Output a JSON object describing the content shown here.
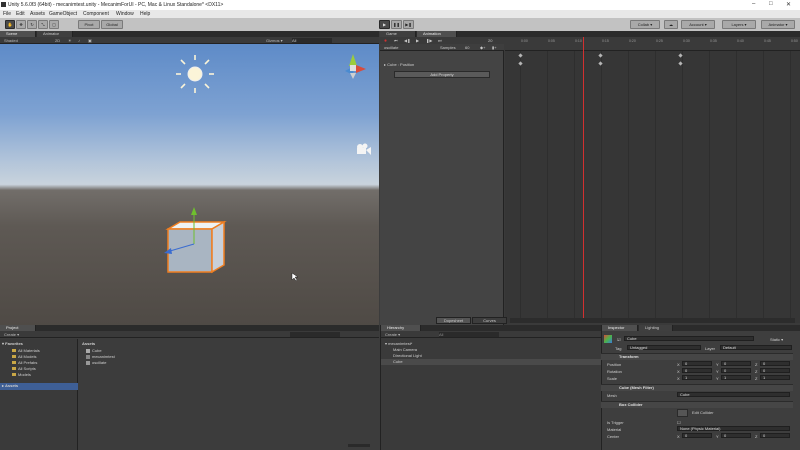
{
  "window": {
    "title": "Unity 5.6.0f3 (64bit) - mecanimtest.unity - MecanimForUI - PC, Mac & Linux Standalone* <DX11>",
    "minimize": "–",
    "maximize": "□",
    "close": "✕"
  },
  "menu": [
    "File",
    "Edit",
    "Assets",
    "GameObject",
    "Component",
    "Window",
    "Help"
  ],
  "toolbar": {
    "pivot": "Pivot",
    "global": "Global",
    "collab": "Collab ▾",
    "account": "Account ▾",
    "layers": "Layers ▾",
    "layout": "Animator ▾"
  },
  "scene": {
    "tabs": [
      "Scene",
      "Animator"
    ],
    "shading": "Shaded",
    "mode_2d": "2D",
    "gizmos": "Gizmos ▾",
    "search": "All"
  },
  "animation": {
    "tabs": [
      "Game",
      "Animation"
    ],
    "clip": "oscillate",
    "samples_label": "Samples",
    "samples": "60",
    "property": "Cube : Position",
    "add_property": "Add Property",
    "frame": "20",
    "ticks": [
      "0:00",
      "0:05",
      "0:10",
      "0:15",
      "0:20",
      "0:25",
      "0:30",
      "0:35",
      "0:40",
      "0:45",
      "0:50"
    ],
    "dopesheet": "Dopesheet",
    "curves": "Curves"
  },
  "project": {
    "tab": "Project",
    "create": "Create ▾",
    "favorites_label": "Favorites",
    "favorites": [
      "All Materials",
      "All Models",
      "All Prefabs",
      "All Scripts",
      "Models"
    ],
    "assets_label": "Assets",
    "assets_header": "Assets",
    "assets": [
      "Cube",
      "mecanimtest",
      "oscillate"
    ]
  },
  "hierarchy": {
    "tab": "Hierarchy",
    "create": "Create ▾",
    "search": "All",
    "scene": "mecanimtest*",
    "items": [
      "Main Camera",
      "Directional Light",
      "Cube"
    ]
  },
  "inspector": {
    "tabs": [
      "Inspector",
      "Lighting"
    ],
    "object_name": "Cube",
    "static": "Static ▾",
    "tag_label": "Tag",
    "tag": "Untagged",
    "layer_label": "Layer",
    "layer": "Default",
    "transform": "Transform",
    "position_label": "Position",
    "rotation_label": "Rotation",
    "scale_label": "Scale",
    "position": [
      "0",
      "0",
      "0"
    ],
    "rotation": [
      "0",
      "0",
      "0"
    ],
    "scale": [
      "1",
      "1",
      "1"
    ],
    "mesh_filter": "Cube (Mesh Filter)",
    "mesh_label": "Mesh",
    "mesh": "Cube",
    "box_collider": "Box Collider",
    "edit_collider": "Edit Collider",
    "is_trigger": "Is Trigger",
    "material_label": "Material",
    "material": "None (Physic Material)",
    "center_label": "Center",
    "center": [
      "0",
      "0",
      "0"
    ]
  }
}
